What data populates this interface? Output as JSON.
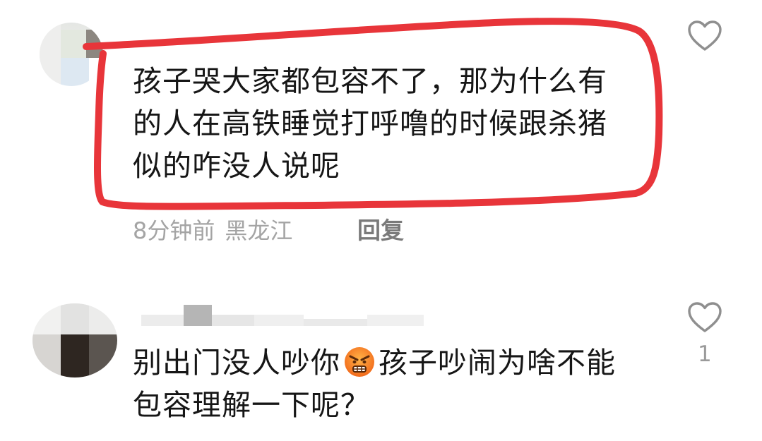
{
  "comments": [
    {
      "text": "孩子哭大家都包容不了，那为什么有的人在高铁睡觉打呼噜的时候跟杀猪似的咋没人说呢",
      "time": "8分钟前",
      "location": "黑龙江",
      "reply_label": "回复",
      "like_count": ""
    },
    {
      "text_before_emoji": "别出门没人吵你",
      "emoji": "angry-face",
      "text_after_emoji": "孩子吵闹为啥不能包容理解一下呢？",
      "like_count": "1"
    }
  ],
  "icons": {
    "like": "heart-outline-icon",
    "emoji": "angry-face-emoji"
  },
  "colors": {
    "highlight": "#e8353a",
    "text": "#161616",
    "meta": "#a4a4a4"
  }
}
